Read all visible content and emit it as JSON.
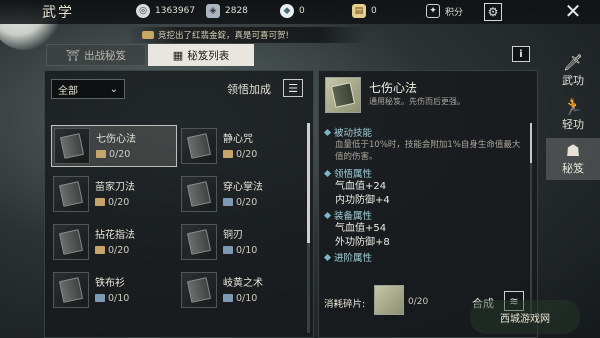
{
  "header": {
    "title": "武学",
    "resources": [
      {
        "icon": "film-reel-icon",
        "glyph": "◎",
        "value": "1363967"
      },
      {
        "icon": "silver-ingot-icon",
        "glyph": "◈",
        "value": "2828"
      },
      {
        "icon": "jade-icon",
        "glyph": "◆",
        "value": "0"
      },
      {
        "icon": "scroll-ticket-icon",
        "glyph": "▤",
        "value": "0"
      }
    ],
    "points_label": "积分",
    "settings_glyph": "⚙",
    "close_glyph": "✕"
  },
  "ticker": {
    "text": "竞挖出了红翡金錠，真是可喜可贺!"
  },
  "tabs": [
    {
      "label": "出战秘笈",
      "glyph": "⛩"
    },
    {
      "label": "秘笈列表",
      "glyph": "▦"
    }
  ],
  "filter": {
    "selected": "全部",
    "arrow": "⌄"
  },
  "comprehend_label": "领悟加成",
  "list_glyph": "☰",
  "items": [
    {
      "name": "七伤心法",
      "count": "0/20",
      "frag": "gold"
    },
    {
      "name": "静心咒",
      "count": "0/20",
      "frag": "gold"
    },
    {
      "name": "苗家刀法",
      "count": "0/20",
      "frag": "gold"
    },
    {
      "name": "穿心掌法",
      "count": "0/20",
      "frag": "blue"
    },
    {
      "name": "拈花指法",
      "count": "0/20",
      "frag": "gold"
    },
    {
      "name": "铜刃",
      "count": "0/10",
      "frag": "blue"
    },
    {
      "name": "铁布衫",
      "count": "0/10",
      "frag": "blue"
    },
    {
      "name": "岐黄之术",
      "count": "0/10",
      "frag": "blue"
    }
  ],
  "info_glyph": "i",
  "detail": {
    "title": "七伤心法",
    "subtitle": "通用秘笈。先伤而后更强。",
    "sections": {
      "passive": "被动技能",
      "passive_desc": "血量低于10%时，技能会附加1%自身生命值最大值的伤害。",
      "comprehend": "领悟属性",
      "comprehend_stats": [
        "气血值+24",
        "内功防御+4"
      ],
      "equip": "装备属性",
      "equip_stats": [
        "气血值+54",
        "外功防御+8"
      ],
      "advance": "进阶属性"
    },
    "cost_label": "消耗碎片:",
    "cost_count": "0/20",
    "craft_label": "合成",
    "craft_glyph": "≋"
  },
  "side_nav": [
    {
      "label": "武功",
      "glyph": "🗡"
    },
    {
      "label": "轻功",
      "glyph": "🏃"
    },
    {
      "label": "秘笈",
      "glyph": "☗"
    }
  ],
  "watermark": "西城游戏网"
}
